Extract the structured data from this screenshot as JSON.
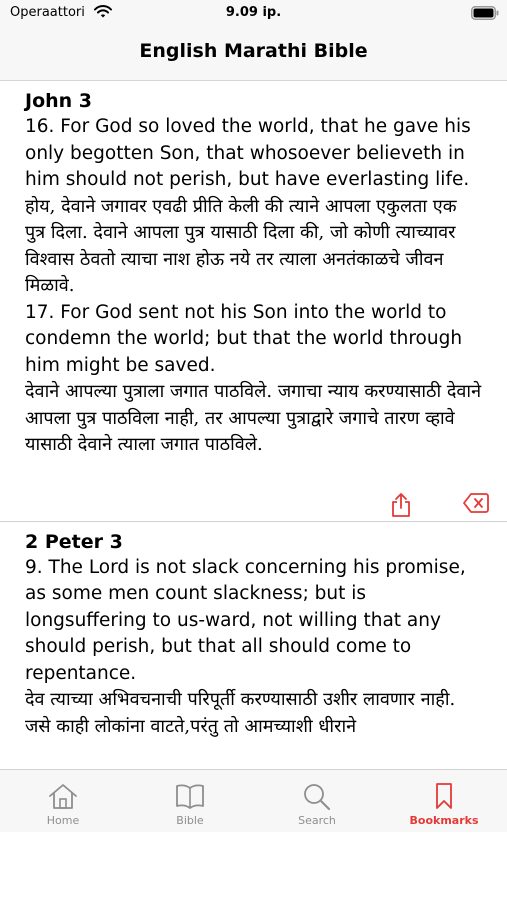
{
  "status_bar": {
    "carrier": "Operaattori",
    "time": "9.09 ip."
  },
  "nav": {
    "title": "English Marathi Bible"
  },
  "bookmarks": [
    {
      "reference": "John 3",
      "verses": [
        {
          "english": "16. For God so loved the world, that he gave his only begotten Son, that whosoever believeth in him should not perish, but have everlasting life.",
          "marathi": "होय, देवाने जगावर एवढी प्रीति केली की त्याने आपला एकुलता एक पुत्र दिला. देवाने आपला पुत्र यासाठी दिला की, जो कोणी त्याच्यावर विश्वास ठेवतो त्याचा नाश होऊ नये तर त्याला अनतंकाळचे जीवन मिळावे."
        },
        {
          "english": "17. For God sent not his Son into the world to condemn the world; but that the world through him might be saved.",
          "marathi": "देवाने आपल्या पुत्राला जगात पाठविले. जगाचा न्याय करण्यासाठी देवाने आपला पुत्र पाठविला नाही, तर आपल्या पुत्राद्वारे जगाचे तारण व्हावे यासाठी देवाने त्याला जगात पाठविले."
        }
      ]
    },
    {
      "reference": "2 Peter 3",
      "verses": [
        {
          "english": "9. The Lord is not slack concerning his promise, as some men count slackness; but is longsuffering to us-ward, not willing that any should perish, but that all should come to repentance.",
          "marathi": "देव त्याच्या अभिवचनाची परिपूर्ती करण्यासाठी उशीर लावणार नाही. जसे काही लोकांना वाटते,परंतु तो आमच्याशी धीराने"
        }
      ]
    }
  ],
  "tabs": [
    {
      "label": "Home",
      "icon": "house-icon"
    },
    {
      "label": "Bible",
      "icon": "book-icon"
    },
    {
      "label": "Search",
      "icon": "magnifier-icon"
    },
    {
      "label": "Bookmarks",
      "icon": "bookmark-icon"
    }
  ],
  "colors": {
    "accent": "#e53935",
    "inactive": "#8e8e8e",
    "bar_background": "#f7f7f7"
  }
}
